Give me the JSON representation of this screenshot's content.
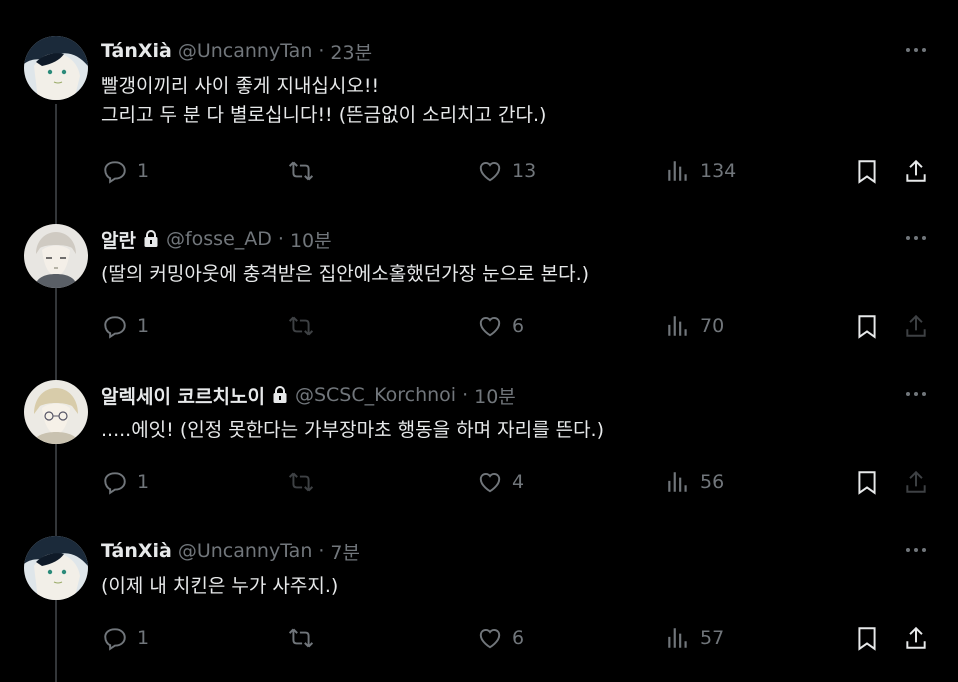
{
  "colors": {
    "background": "#000000",
    "text": "#e7e9ea",
    "muted": "#71767b",
    "thread_line": "#333639"
  },
  "tweets": [
    {
      "name": "TánXià",
      "handle": "@UncannyTan",
      "sep": "·",
      "time": "23분",
      "locked": false,
      "text": "빨갱이끼리 사이 좋게 지내십시오!!\n그리고 두 분 다 별로십니다!! (뜬금없이 소리치고 간다.)",
      "replies": "1",
      "retweets": "",
      "likes": "13",
      "views": "134"
    },
    {
      "name": "알란",
      "handle": "@fosse_AD",
      "sep": "·",
      "time": "10분",
      "locked": true,
      "text": "(딸의 커밍아웃에 충격받은 집안에소홀했던가장 눈으로 본다.)",
      "replies": "1",
      "retweets": "",
      "likes": "6",
      "views": "70"
    },
    {
      "name": "알렉세이 코르치노이",
      "handle": "@SCSC_Korchnoi",
      "sep": "·",
      "time": "10분",
      "locked": true,
      "text": ".....에잇! (인정 못한다는 가부장마초 행동을 하며 자리를 뜬다.)",
      "replies": "1",
      "retweets": "",
      "likes": "4",
      "views": "56"
    },
    {
      "name": "TánXià",
      "handle": "@UncannyTan",
      "sep": "·",
      "time": "7분",
      "locked": false,
      "text": "(이제 내 치킨은 누가 사주지.)",
      "replies": "1",
      "retweets": "",
      "likes": "6",
      "views": "57"
    }
  ],
  "icons": {
    "more": "more-horizontal-icon",
    "reply": "reply-icon",
    "retweet": "retweet-icon",
    "like": "heart-icon",
    "views": "analytics-icon",
    "bookmark": "bookmark-icon",
    "share": "share-icon",
    "lock": "lock-icon"
  }
}
